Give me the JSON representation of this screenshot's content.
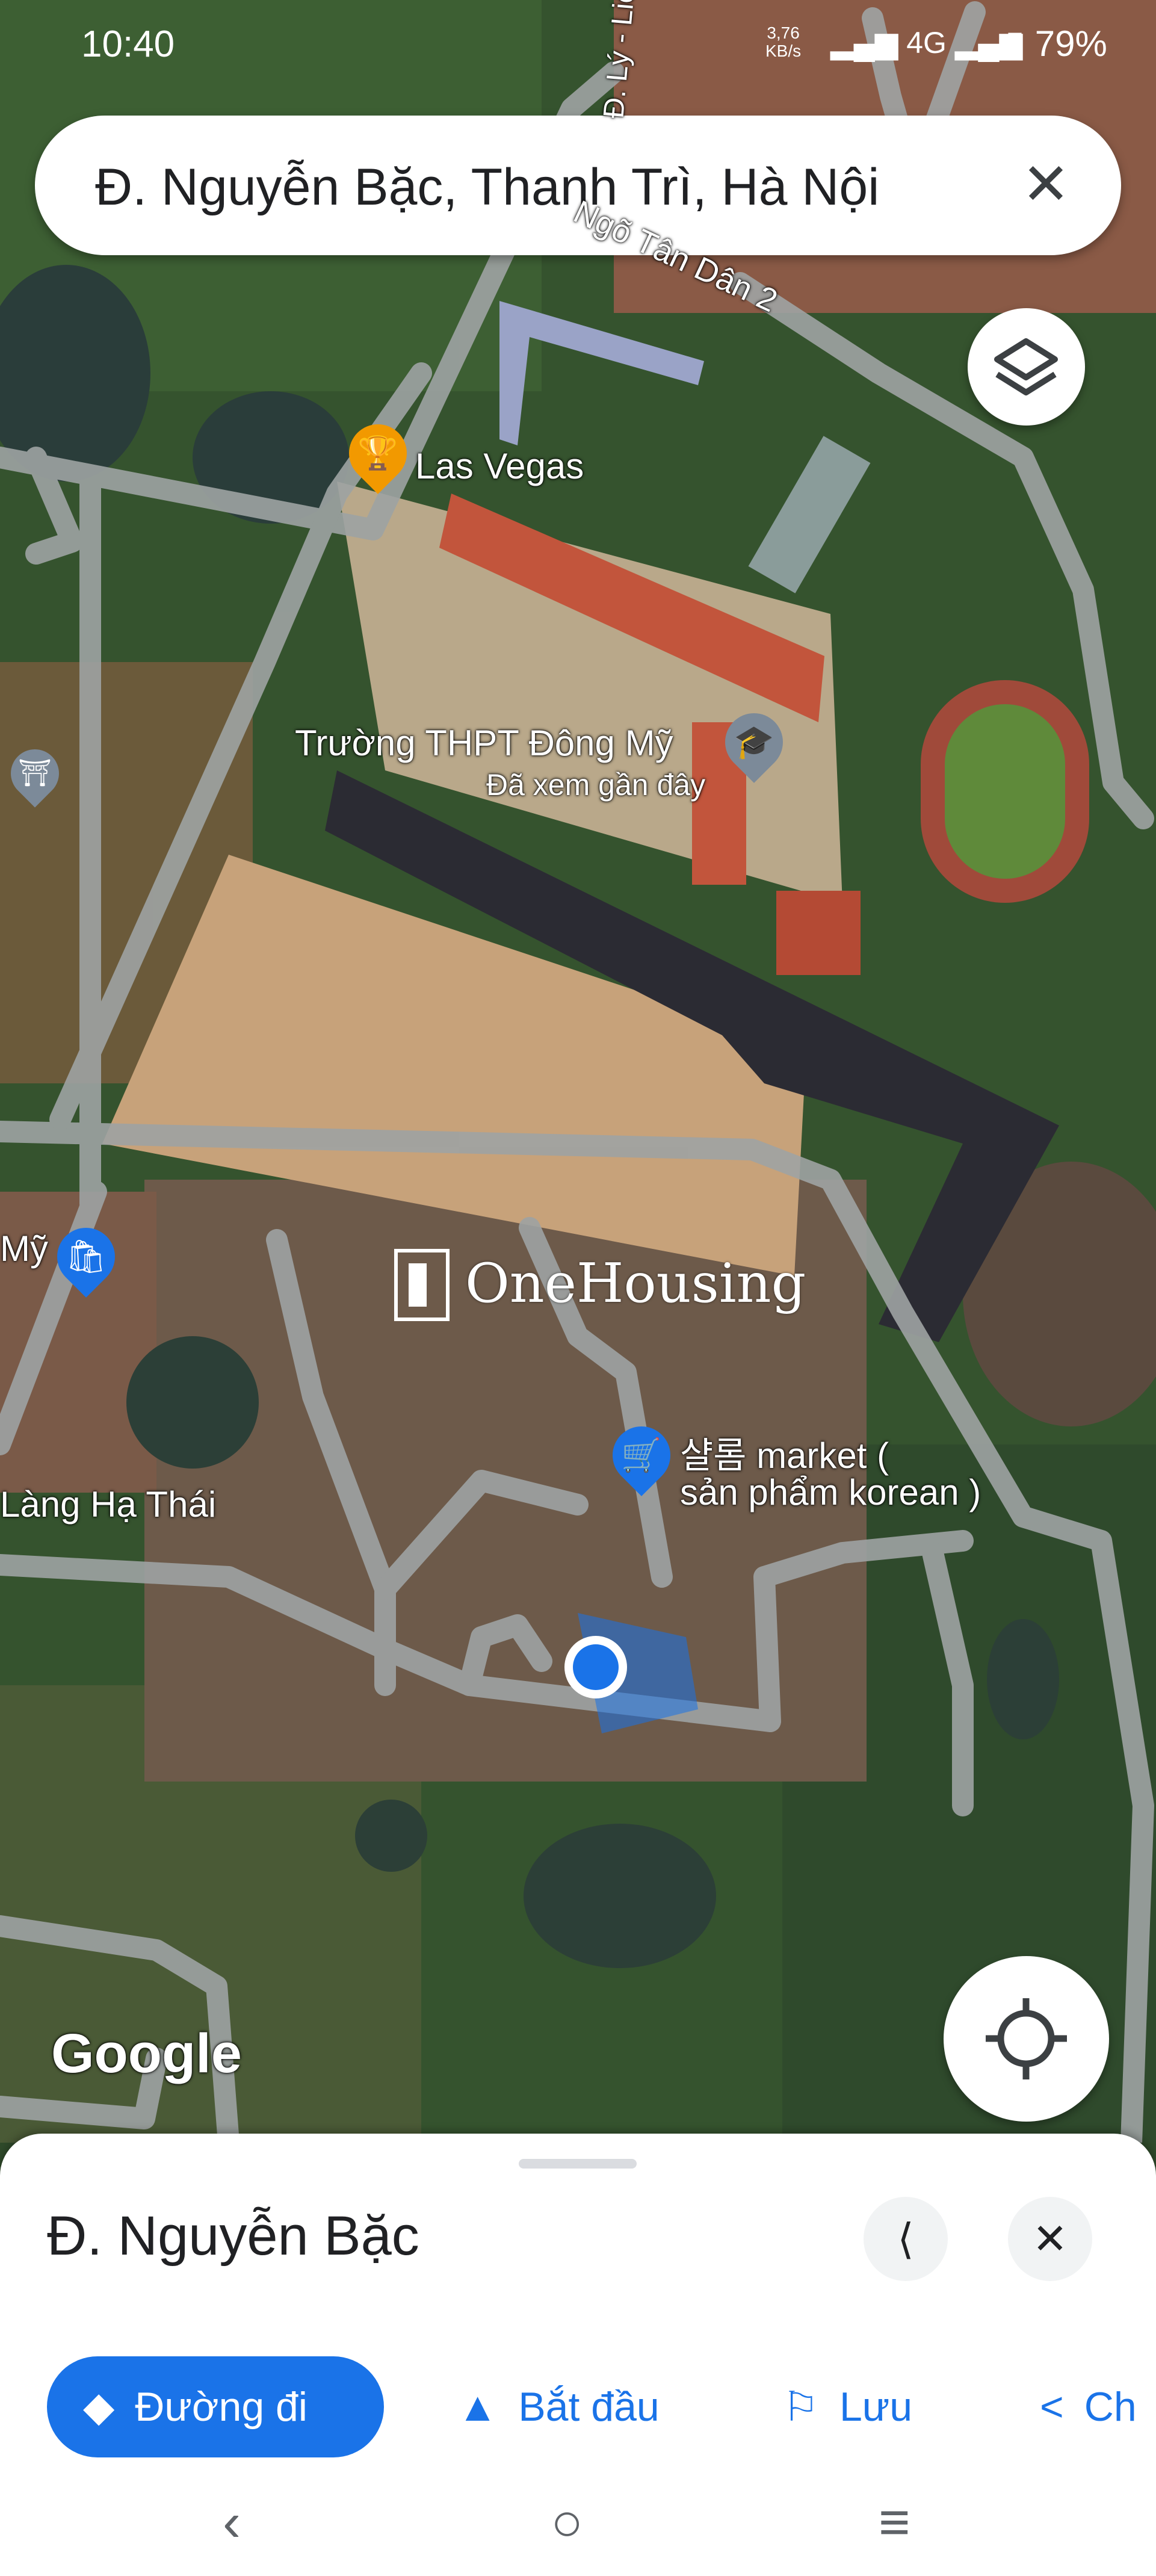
{
  "status_bar": {
    "time": "10:40",
    "net_speed_value": "3,76",
    "net_speed_unit": "KB/s",
    "signal_text": "4G",
    "battery": "79%"
  },
  "search": {
    "query": "Đ. Nguyễn Bặc, Thanh Trì, Hà Nội"
  },
  "map": {
    "street_labels": [
      "Ngõ Tân Dân 2",
      "Đ. Lý - Liê"
    ],
    "places": [
      {
        "name": "Las Vegas",
        "icon": "trophy-icon",
        "color": "#f29900"
      },
      {
        "name": "Trường THPT Đông Mỹ",
        "subtitle": "Đã xem gần đây",
        "icon": "school-icon",
        "color": "#7c8a99"
      },
      {
        "name": "샬롬 market (",
        "name_line2": "sản phẩm korean )",
        "icon": "shopping-cart-icon",
        "color": "#1a73e8"
      },
      {
        "name": "Làng Hạ Thái"
      },
      {
        "name": "Mỹ"
      }
    ],
    "watermark": "OneHousing",
    "attribution": "Google"
  },
  "sheet": {
    "title": "Đ. Nguyễn Bặc",
    "actions": [
      {
        "label": "Đường đi",
        "icon": "directions-icon"
      },
      {
        "label": "Bắt đầu",
        "icon": "navigation-arrow-icon"
      },
      {
        "label": "Lưu",
        "icon": "bookmark-icon"
      },
      {
        "label": "Ch",
        "icon": "share-icon"
      }
    ]
  },
  "colors": {
    "accent": "#1a73e8",
    "location_dot": "#1a73e8"
  }
}
